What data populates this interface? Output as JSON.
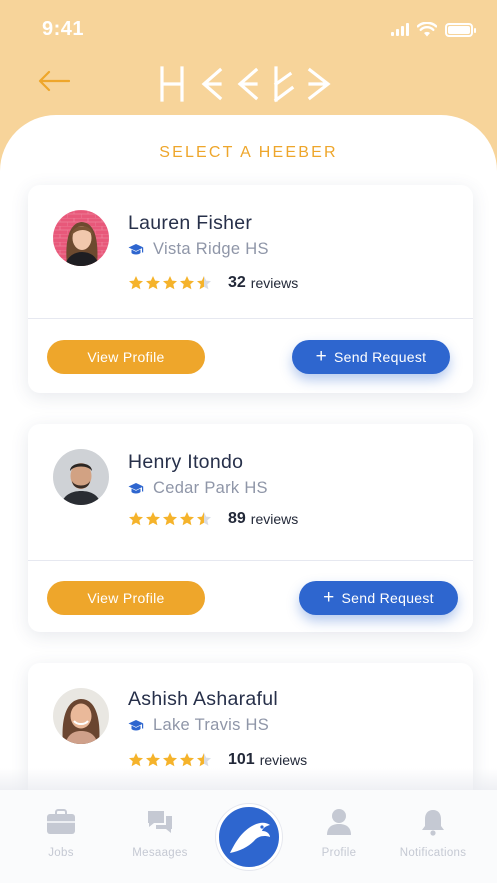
{
  "status_bar": {
    "time": "9:41"
  },
  "header": {
    "back_icon": "arrow-left-icon",
    "logo_alt": "HEEBER"
  },
  "page": {
    "title": "SELECT A HEEBER"
  },
  "cards": [
    {
      "name": "Lauren Fisher",
      "school": "Vista Ridge HS",
      "rating": 4.5,
      "review_count": "32",
      "review_label": "reviews",
      "view_label": "View Profile",
      "send_label": "Send Request"
    },
    {
      "name": "Henry Itondo",
      "school": "Cedar Park HS",
      "rating": 4.5,
      "review_count": "89",
      "review_label": "reviews",
      "view_label": "View Profile",
      "send_label": "Send Request"
    },
    {
      "name": "Ashish Asharaful",
      "school": "Lake Travis HS",
      "rating": 4.5,
      "review_count": "101",
      "review_label": "reviews"
    }
  ],
  "nav": {
    "items": [
      {
        "label": "Jobs",
        "icon": "briefcase-icon"
      },
      {
        "label": "Mesaages",
        "icon": "chat-icon"
      },
      {
        "label": "",
        "icon": "heeber-bird-icon"
      },
      {
        "label": "Profile",
        "icon": "user-icon"
      },
      {
        "label": "Notifications",
        "icon": "bell-icon"
      }
    ]
  },
  "colors": {
    "header_bg": "#f7d49a",
    "accent_orange": "#eea62b",
    "accent_blue": "#2e66cf",
    "star": "#f5b32b",
    "star_empty": "#d9dce3"
  }
}
